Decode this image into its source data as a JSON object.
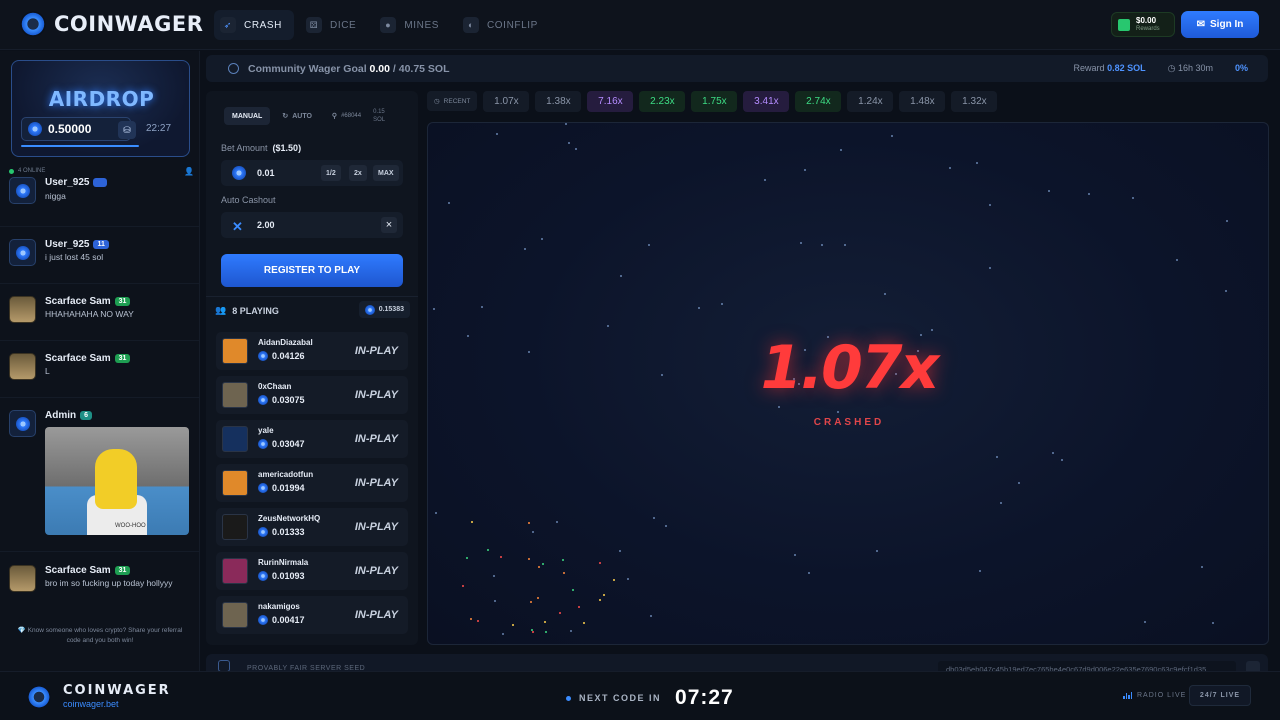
{
  "header": {
    "brand": "COINWAGER",
    "nav": [
      {
        "label": "CRASH",
        "icon": "rocket-icon",
        "active": true
      },
      {
        "label": "DICE",
        "icon": "dice-icon",
        "active": false
      },
      {
        "label": "MINES",
        "icon": "bomb-icon",
        "active": false
      },
      {
        "label": "COINFLIP",
        "icon": "coin-icon",
        "active": false
      }
    ],
    "rewards_amount": "$0.00",
    "rewards_label": "Rewards",
    "sign_in": "Sign In"
  },
  "airdrop": {
    "title": "AIRDROP",
    "value": "0.50000",
    "timer": "22:27"
  },
  "chat": {
    "online": "4 ONLINE",
    "messages": [
      {
        "name": "User_925",
        "level": "",
        "text": "nigga"
      },
      {
        "name": "User_925",
        "level": "11",
        "text": "i just lost 45 sol"
      },
      {
        "name": "Scarface Sam",
        "level": "31",
        "text": "HHAHAHAHA NO WAY"
      },
      {
        "name": "Scarface Sam",
        "level": "31",
        "text": "L"
      },
      {
        "name": "Admin",
        "level": "6",
        "text": ""
      },
      {
        "name": "Scarface Sam",
        "level": "31",
        "text": "bro im so fucking up today hollyyy"
      }
    ],
    "gif_caption": "WOO-HOO",
    "referral": "Know someone who loves crypto? Share your referral code and you both win!"
  },
  "wager": {
    "label": "Community Wager Goal",
    "current": "0.00",
    "goal": "/ 40.75 SOL",
    "reward_label": "Reward",
    "reward_value": "0.82 SOL",
    "time": "16h 30m",
    "percent": "0%"
  },
  "bet": {
    "modes": [
      "MANUAL",
      "AUTO"
    ],
    "round": "#68044",
    "sol_top": "0.15",
    "sol_bottom": "SOL",
    "bet_label": "Bet Amount",
    "bet_usd": "($1.50)",
    "bet_value": "0.01",
    "half": "1/2",
    "double": "2x",
    "max": "MAX",
    "cashout_label": "Auto Cashout",
    "cashout_value": "2.00",
    "register": "REGISTER TO PLAY"
  },
  "players": {
    "label": "8 PLAYING",
    "total": "0.15383",
    "list": [
      {
        "name": "AidanDiazabal",
        "amount": "0.04126",
        "status": "IN-PLAY",
        "color": "#e0892a"
      },
      {
        "name": "0xChaan",
        "amount": "0.03075",
        "status": "IN-PLAY",
        "color": "#6e6450"
      },
      {
        "name": "yale",
        "amount": "0.03047",
        "status": "IN-PLAY",
        "color": "#15305e"
      },
      {
        "name": "americadotfun",
        "amount": "0.01994",
        "status": "IN-PLAY",
        "color": "#e0892a"
      },
      {
        "name": "ZeusNetworkHQ",
        "amount": "0.01333",
        "status": "IN-PLAY",
        "color": "#1a1a1a"
      },
      {
        "name": "RurinNirmala",
        "amount": "0.01093",
        "status": "IN-PLAY",
        "color": "#8a2a5a"
      },
      {
        "name": "nakamigos",
        "amount": "0.00417",
        "status": "IN-PLAY",
        "color": "#6e6450"
      }
    ]
  },
  "recent": {
    "label": "RECENT",
    "items": [
      {
        "value": "1.07x",
        "tone": "gray"
      },
      {
        "value": "1.38x",
        "tone": "gray"
      },
      {
        "value": "7.16x",
        "tone": "purple"
      },
      {
        "value": "2.23x",
        "tone": "green"
      },
      {
        "value": "1.75x",
        "tone": "green"
      },
      {
        "value": "3.41x",
        "tone": "purple"
      },
      {
        "value": "2.74x",
        "tone": "green"
      },
      {
        "value": "1.24x",
        "tone": "gray"
      },
      {
        "value": "1.48x",
        "tone": "gray"
      },
      {
        "value": "1.32x",
        "tone": "gray"
      }
    ]
  },
  "game": {
    "multiplier": "1.07x",
    "state": "CRASHED"
  },
  "provably_fair": {
    "label": "PROVABLY FAIR SERVER SEED",
    "hash": "db03d5eb047c45b19ed7ec765be4e0c67d9d006e22e635e7690c63c9efcf1d35"
  },
  "footer": {
    "brand": "COINWAGER",
    "site": "coinwager.bet",
    "next_label": "NEXT CODE IN",
    "next_time": "07:27",
    "radio": "RADIO LIVE",
    "live": "24/7 LIVE"
  }
}
